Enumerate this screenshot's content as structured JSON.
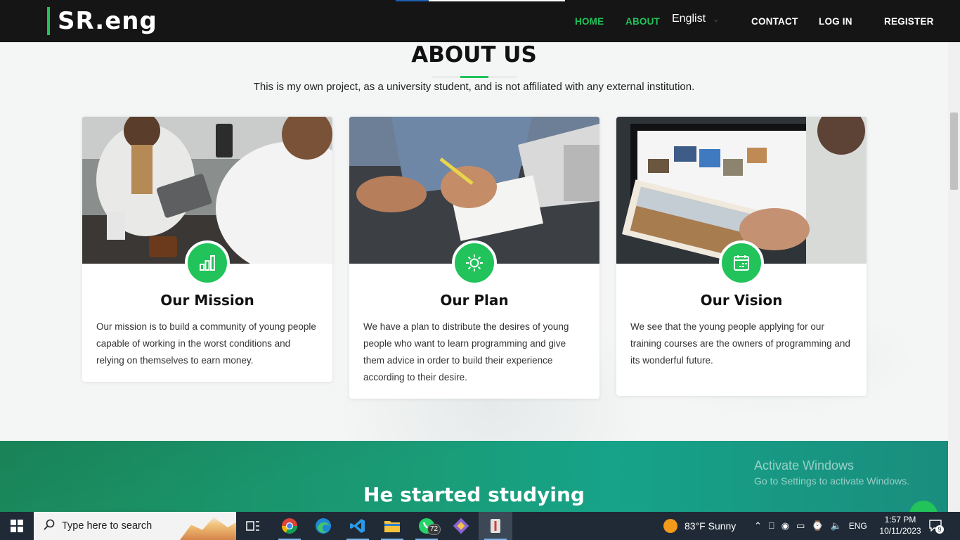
{
  "header": {
    "logo": "SR.eng",
    "nav": {
      "home": "HOME",
      "about": "ABOUT",
      "contact": "CONTACT",
      "login": "LOG IN",
      "register": "REGISTER"
    },
    "language": "Englist",
    "accent_color": "#21c35a"
  },
  "about": {
    "title": "ABOUT US",
    "intro": "This is my own project, as a university student, and is not affiliated with any external institution.",
    "cards": [
      {
        "icon": "bar-chart-icon",
        "title": "Our Mission",
        "text": "Our mission is to build a community of young people capable of working in the worst conditions and relying on themselves to earn money."
      },
      {
        "icon": "sun-icon",
        "title": "Our Plan",
        "text": "We have a plan to distribute the desires of young people who want to learn programming and give them advice in order to build their experience according to their desire."
      },
      {
        "icon": "calendar-icon",
        "title": "Our Vision",
        "text": "We see that the young people applying for our training courses are the owners of programming and its wonderful future."
      }
    ]
  },
  "band": {
    "title": "He started studying"
  },
  "watermark": {
    "line1": "Activate Windows",
    "line2": "Go to Settings to activate Windows."
  },
  "taskbar": {
    "search_placeholder": "Type here to search",
    "whatsapp_badge": "72",
    "weather": "83°F  Sunny",
    "language": "ENG",
    "time": "1:57 PM",
    "date": "10/11/2023",
    "notifications": "9"
  }
}
